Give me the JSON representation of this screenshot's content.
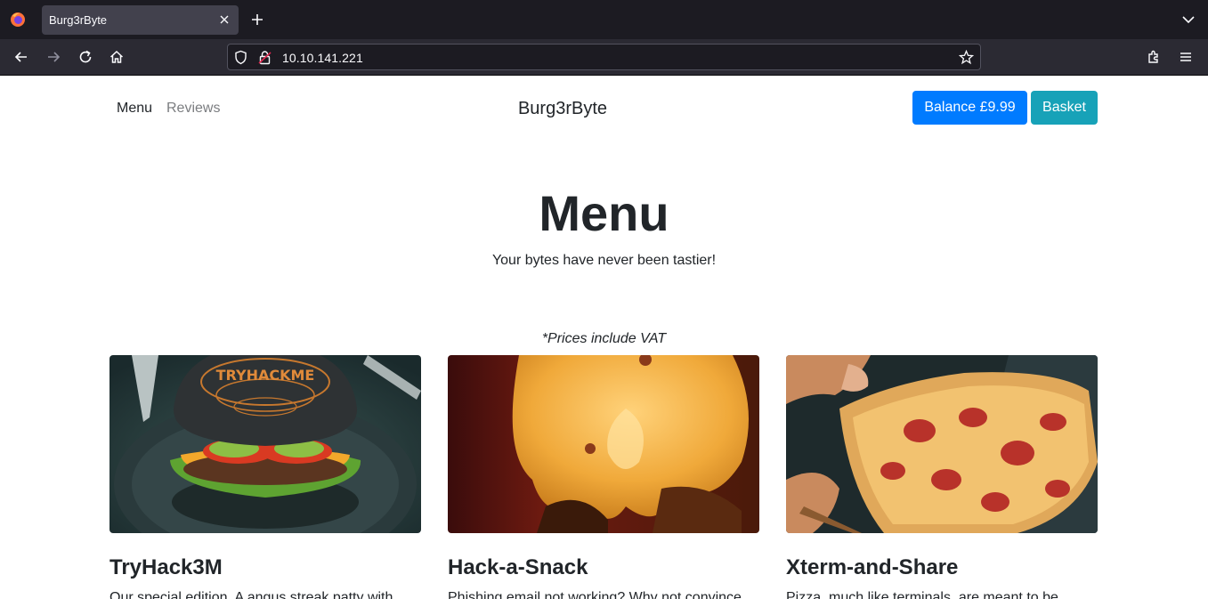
{
  "browser": {
    "tab_title": "Burg3rByte",
    "url": "10.10.141.221",
    "icons": [
      "firefox-logo",
      "close-icon",
      "plus-icon",
      "chevron-down-icon",
      "back-icon",
      "forward-icon",
      "reload-icon",
      "home-icon",
      "shield-icon",
      "lock-icon",
      "star-icon",
      "extensions-icon",
      "hamburger-menu-icon"
    ]
  },
  "nav": {
    "menu": "Menu",
    "reviews": "Reviews",
    "brand": "Burg3rByte",
    "balance": "Balance £9.99",
    "basket": "Basket"
  },
  "hero": {
    "title": "Menu",
    "subtitle": "Your bytes have never been tastier!"
  },
  "vat_note": "*Prices include VAT",
  "items": [
    {
      "name": "TryHack3M",
      "desc": "Our special edition. A angus streak patty with",
      "image_text": "TRYHACKME"
    },
    {
      "name": "Hack-a-Snack",
      "desc": "Phishing email not working? Why not convince"
    },
    {
      "name": "Xterm-and-Share",
      "desc": "Pizza, much like terminals, are meant to be"
    }
  ],
  "colors": {
    "primary": "#007bff",
    "info": "#17a2b8",
    "chrome_dark": "#1c1b22",
    "chrome_toolbar": "#2b2a33"
  }
}
